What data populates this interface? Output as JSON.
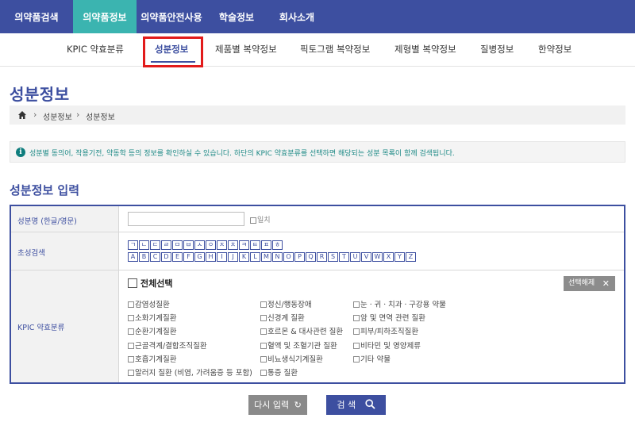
{
  "top_nav": [
    "의약품검색",
    "의약품정보",
    "의약품안전사용",
    "학술정보",
    "회사소개"
  ],
  "sub_nav": [
    "KPIC 약효분류",
    "성분정보",
    "제품별 복약정보",
    "픽토그램 복약정보",
    "제형별 복약정보",
    "질병정보",
    "한약정보"
  ],
  "page_title": "성분정보",
  "breadcrumb": [
    "성분정보",
    "성분정보"
  ],
  "info_text": "성분별 동의어, 작용기전, 약동학 등의 정보를 확인하실 수 있습니다. 하단의 KPIC 약효분류를 선택하면 해당되는 성분 목록이 함께 검색됩니다.",
  "section_title": "성분정보 입력",
  "form": {
    "ingredient_label": "성분명 (한글/영문)",
    "ingredient_value": "",
    "exact_label": "일치",
    "initial_label": "초성검색",
    "hangul_keys": [
      "ㄱ",
      "ㄴ",
      "ㄷ",
      "ㄹ",
      "ㅁ",
      "ㅂ",
      "ㅅ",
      "ㅇ",
      "ㅈ",
      "ㅊ",
      "ㅋ",
      "ㅌ",
      "ㅍ",
      "ㅎ"
    ],
    "alpha_keys": [
      "A",
      "B",
      "C",
      "D",
      "E",
      "F",
      "G",
      "H",
      "I",
      "J",
      "K",
      "L",
      "M",
      "N",
      "O",
      "P",
      "Q",
      "R",
      "S",
      "T",
      "U",
      "V",
      "W",
      "X",
      "Y",
      "Z"
    ],
    "kpic_label": "KPIC 약효분류",
    "select_all": "전체선택",
    "deselect": "선택해제",
    "categories": [
      [
        "감염성질환",
        "소화기계질환",
        "순환기계질환",
        "근골격계/결합조직질환",
        "호흡기계질환",
        "알러지 질환 (비염, 가려움증 등 포함)"
      ],
      [
        "정신/행동장애",
        "신경계 질환",
        "호르몬 & 대사관련 질환",
        "혈액 및 조혈기관 질환",
        "비뇨생식기계질환",
        "통증 질환"
      ],
      [
        "눈ㆍ귀ㆍ치과ㆍ구강용 약물",
        "암 및 면역 관련 질환",
        "피부/피하조직질환",
        "비타민 및 영양제류",
        "기타 약물"
      ]
    ]
  },
  "buttons": {
    "reset": "다시 입력",
    "search": "검 색"
  },
  "colors": {
    "primary": "#3d4fa0",
    "active_tab": "#3bb4b0",
    "highlight": "#e21b1b"
  }
}
